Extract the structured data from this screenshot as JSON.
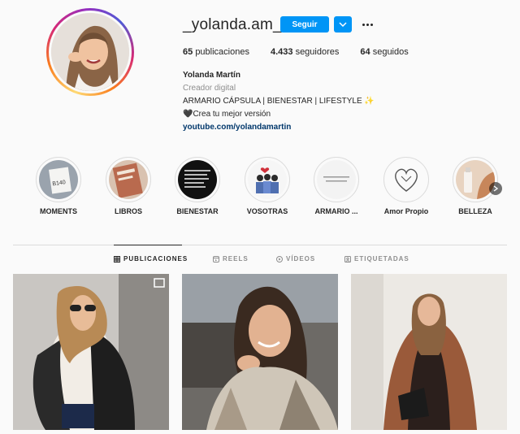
{
  "profile": {
    "username": "_yolanda.am_",
    "follow_label": "Seguir",
    "stats": {
      "posts_value": "65",
      "posts_label": "publicaciones",
      "followers_value": "4.433",
      "followers_label": "seguidores",
      "following_value": "64",
      "following_label": "seguidos"
    },
    "bio": {
      "name": "Yolanda Martín",
      "category": "Creador digital",
      "line1": "ARMARIO CÁPSULA | BIENESTAR | LIFESTYLE ✨",
      "line2": "🖤Crea tu mejor versión",
      "link": "youtube.com/yolandamartin"
    }
  },
  "highlights": [
    {
      "label": "MOMENTS"
    },
    {
      "label": "LIBROS"
    },
    {
      "label": "BIENESTAR"
    },
    {
      "label": "VOSOTRAS"
    },
    {
      "label": "ARMARIO ..."
    },
    {
      "label": "Amor Propio"
    },
    {
      "label": "BELLEZA"
    }
  ],
  "tabs": [
    {
      "label": "PUBLICACIONES",
      "icon": "grid-icon",
      "active": true
    },
    {
      "label": "REELS",
      "icon": "reels-icon",
      "active": false
    },
    {
      "label": "VÍDEOS",
      "icon": "video-icon",
      "active": false
    },
    {
      "label": "ETIQUETADAS",
      "icon": "tag-icon",
      "active": false
    }
  ],
  "colors": {
    "accent": "#0095f6",
    "text": "#262626",
    "muted": "#8e8e8e",
    "link": "#00376b",
    "divider": "#dbdbdb"
  }
}
